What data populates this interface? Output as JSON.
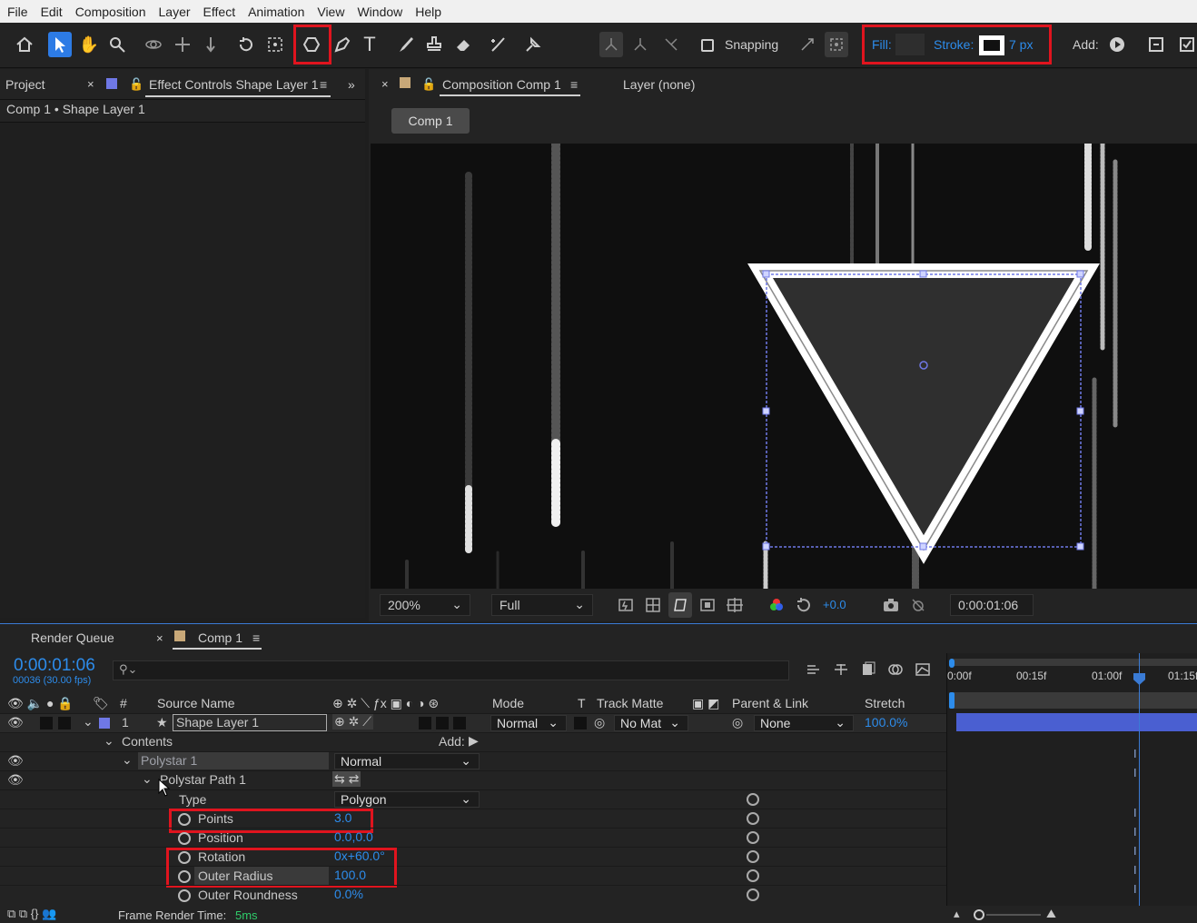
{
  "menu": [
    "File",
    "Edit",
    "Composition",
    "Layer",
    "Effect",
    "Animation",
    "View",
    "Window",
    "Help"
  ],
  "toolbar": {
    "snapping_label": "Snapping",
    "fill_label": "Fill:",
    "stroke_label": "Stroke:",
    "stroke_width": "7 px",
    "add_label": "Add:"
  },
  "project_panel": {
    "tab_project": "Project",
    "tab_effect_controls": "Effect Controls Shape Layer 1",
    "breadcrumb": "Comp 1 • Shape Layer 1"
  },
  "comp_panel": {
    "tab_composition": "Composition Comp 1",
    "layer_label": "Layer (none)",
    "comp_button": "Comp 1",
    "zoom": "200%",
    "resolution": "Full",
    "exposure": "+0.0",
    "timecode": "0:00:01:06"
  },
  "timeline": {
    "tab_render_queue": "Render Queue",
    "tab_comp": "Comp 1",
    "timecode": "0:00:01:06",
    "frames_fps": "00036 (30.00 fps)",
    "search_placeholder": "",
    "columns": {
      "number": "#",
      "source_name": "Source Name",
      "mode": "Mode",
      "t": "T",
      "track_matte": "Track Matte",
      "parent_link": "Parent & Link",
      "stretch": "Stretch"
    },
    "layer": {
      "index": "1",
      "name": "Shape Layer 1",
      "mode": "Normal",
      "track_matte": "No Mat",
      "parent": "None",
      "stretch": "100.0%"
    },
    "contents_label": "Contents",
    "add_label": "Add:",
    "polystar_label": "Polystar 1",
    "polystar_mode": "Normal",
    "polystar_path_label": "Polystar Path 1",
    "properties": {
      "type_label": "Type",
      "type_value": "Polygon",
      "points_label": "Points",
      "points_value": "3.0",
      "position_label": "Position",
      "position_value": "0.0,0.0",
      "rotation_label": "Rotation",
      "rotation_value": "0x+60.0°",
      "outer_radius_label": "Outer Radius",
      "outer_radius_value": "100.0",
      "outer_roundness_label": "Outer Roundness",
      "outer_roundness_value": "0.0%"
    },
    "ruler": [
      "0:00f",
      "00:15f",
      "01:00f",
      "01:15f"
    ],
    "frame_render_label": "Frame Render Time:",
    "frame_render_value": "5ms"
  },
  "colors": {
    "accent_blue": "#2d8ceb",
    "highlight_red": "#e0141e",
    "label_lavender": "#6f78e6",
    "label_tan": "#c8a878"
  }
}
